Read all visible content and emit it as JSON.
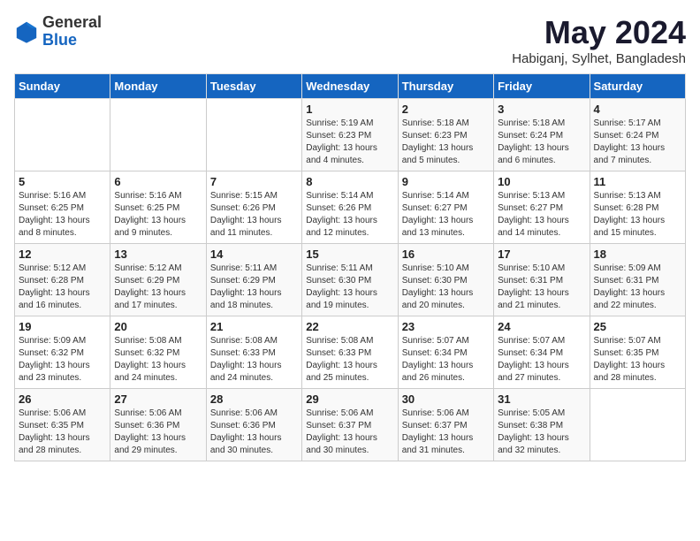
{
  "header": {
    "logo_general": "General",
    "logo_blue": "Blue",
    "month": "May 2024",
    "location": "Habiganj, Sylhet, Bangladesh"
  },
  "days_of_week": [
    "Sunday",
    "Monday",
    "Tuesday",
    "Wednesday",
    "Thursday",
    "Friday",
    "Saturday"
  ],
  "weeks": [
    [
      {
        "num": "",
        "info": ""
      },
      {
        "num": "",
        "info": ""
      },
      {
        "num": "",
        "info": ""
      },
      {
        "num": "1",
        "info": "Sunrise: 5:19 AM\nSunset: 6:23 PM\nDaylight: 13 hours and 4 minutes."
      },
      {
        "num": "2",
        "info": "Sunrise: 5:18 AM\nSunset: 6:23 PM\nDaylight: 13 hours and 5 minutes."
      },
      {
        "num": "3",
        "info": "Sunrise: 5:18 AM\nSunset: 6:24 PM\nDaylight: 13 hours and 6 minutes."
      },
      {
        "num": "4",
        "info": "Sunrise: 5:17 AM\nSunset: 6:24 PM\nDaylight: 13 hours and 7 minutes."
      }
    ],
    [
      {
        "num": "5",
        "info": "Sunrise: 5:16 AM\nSunset: 6:25 PM\nDaylight: 13 hours and 8 minutes."
      },
      {
        "num": "6",
        "info": "Sunrise: 5:16 AM\nSunset: 6:25 PM\nDaylight: 13 hours and 9 minutes."
      },
      {
        "num": "7",
        "info": "Sunrise: 5:15 AM\nSunset: 6:26 PM\nDaylight: 13 hours and 11 minutes."
      },
      {
        "num": "8",
        "info": "Sunrise: 5:14 AM\nSunset: 6:26 PM\nDaylight: 13 hours and 12 minutes."
      },
      {
        "num": "9",
        "info": "Sunrise: 5:14 AM\nSunset: 6:27 PM\nDaylight: 13 hours and 13 minutes."
      },
      {
        "num": "10",
        "info": "Sunrise: 5:13 AM\nSunset: 6:27 PM\nDaylight: 13 hours and 14 minutes."
      },
      {
        "num": "11",
        "info": "Sunrise: 5:13 AM\nSunset: 6:28 PM\nDaylight: 13 hours and 15 minutes."
      }
    ],
    [
      {
        "num": "12",
        "info": "Sunrise: 5:12 AM\nSunset: 6:28 PM\nDaylight: 13 hours and 16 minutes."
      },
      {
        "num": "13",
        "info": "Sunrise: 5:12 AM\nSunset: 6:29 PM\nDaylight: 13 hours and 17 minutes."
      },
      {
        "num": "14",
        "info": "Sunrise: 5:11 AM\nSunset: 6:29 PM\nDaylight: 13 hours and 18 minutes."
      },
      {
        "num": "15",
        "info": "Sunrise: 5:11 AM\nSunset: 6:30 PM\nDaylight: 13 hours and 19 minutes."
      },
      {
        "num": "16",
        "info": "Sunrise: 5:10 AM\nSunset: 6:30 PM\nDaylight: 13 hours and 20 minutes."
      },
      {
        "num": "17",
        "info": "Sunrise: 5:10 AM\nSunset: 6:31 PM\nDaylight: 13 hours and 21 minutes."
      },
      {
        "num": "18",
        "info": "Sunrise: 5:09 AM\nSunset: 6:31 PM\nDaylight: 13 hours and 22 minutes."
      }
    ],
    [
      {
        "num": "19",
        "info": "Sunrise: 5:09 AM\nSunset: 6:32 PM\nDaylight: 13 hours and 23 minutes."
      },
      {
        "num": "20",
        "info": "Sunrise: 5:08 AM\nSunset: 6:32 PM\nDaylight: 13 hours and 24 minutes."
      },
      {
        "num": "21",
        "info": "Sunrise: 5:08 AM\nSunset: 6:33 PM\nDaylight: 13 hours and 24 minutes."
      },
      {
        "num": "22",
        "info": "Sunrise: 5:08 AM\nSunset: 6:33 PM\nDaylight: 13 hours and 25 minutes."
      },
      {
        "num": "23",
        "info": "Sunrise: 5:07 AM\nSunset: 6:34 PM\nDaylight: 13 hours and 26 minutes."
      },
      {
        "num": "24",
        "info": "Sunrise: 5:07 AM\nSunset: 6:34 PM\nDaylight: 13 hours and 27 minutes."
      },
      {
        "num": "25",
        "info": "Sunrise: 5:07 AM\nSunset: 6:35 PM\nDaylight: 13 hours and 28 minutes."
      }
    ],
    [
      {
        "num": "26",
        "info": "Sunrise: 5:06 AM\nSunset: 6:35 PM\nDaylight: 13 hours and 28 minutes."
      },
      {
        "num": "27",
        "info": "Sunrise: 5:06 AM\nSunset: 6:36 PM\nDaylight: 13 hours and 29 minutes."
      },
      {
        "num": "28",
        "info": "Sunrise: 5:06 AM\nSunset: 6:36 PM\nDaylight: 13 hours and 30 minutes."
      },
      {
        "num": "29",
        "info": "Sunrise: 5:06 AM\nSunset: 6:37 PM\nDaylight: 13 hours and 30 minutes."
      },
      {
        "num": "30",
        "info": "Sunrise: 5:06 AM\nSunset: 6:37 PM\nDaylight: 13 hours and 31 minutes."
      },
      {
        "num": "31",
        "info": "Sunrise: 5:05 AM\nSunset: 6:38 PM\nDaylight: 13 hours and 32 minutes."
      },
      {
        "num": "",
        "info": ""
      }
    ]
  ]
}
